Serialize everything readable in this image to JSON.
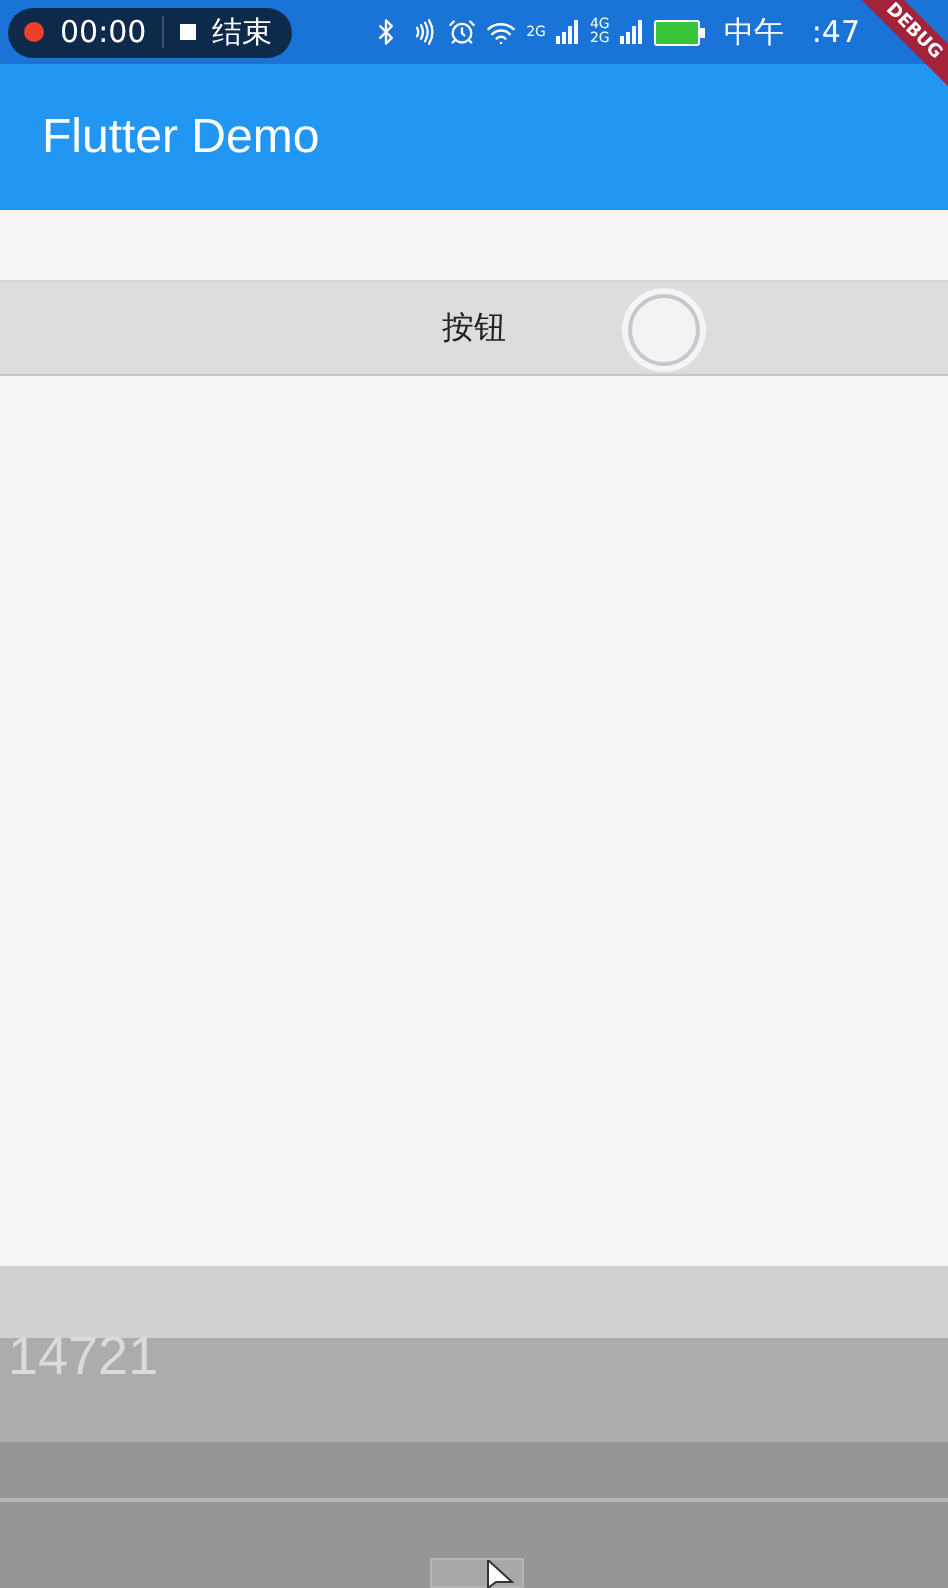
{
  "status_bar": {
    "recording": {
      "time": "00:00",
      "stop_label": "结束"
    },
    "network_labels": [
      "2G",
      "4G",
      "2G"
    ],
    "clock": [
      "中午",
      ":47"
    ]
  },
  "debug_banner": "DEBUG",
  "app_bar": {
    "title": "Flutter Demo"
  },
  "button": {
    "label": "按钮"
  },
  "overlay": {
    "counter": "14721"
  }
}
